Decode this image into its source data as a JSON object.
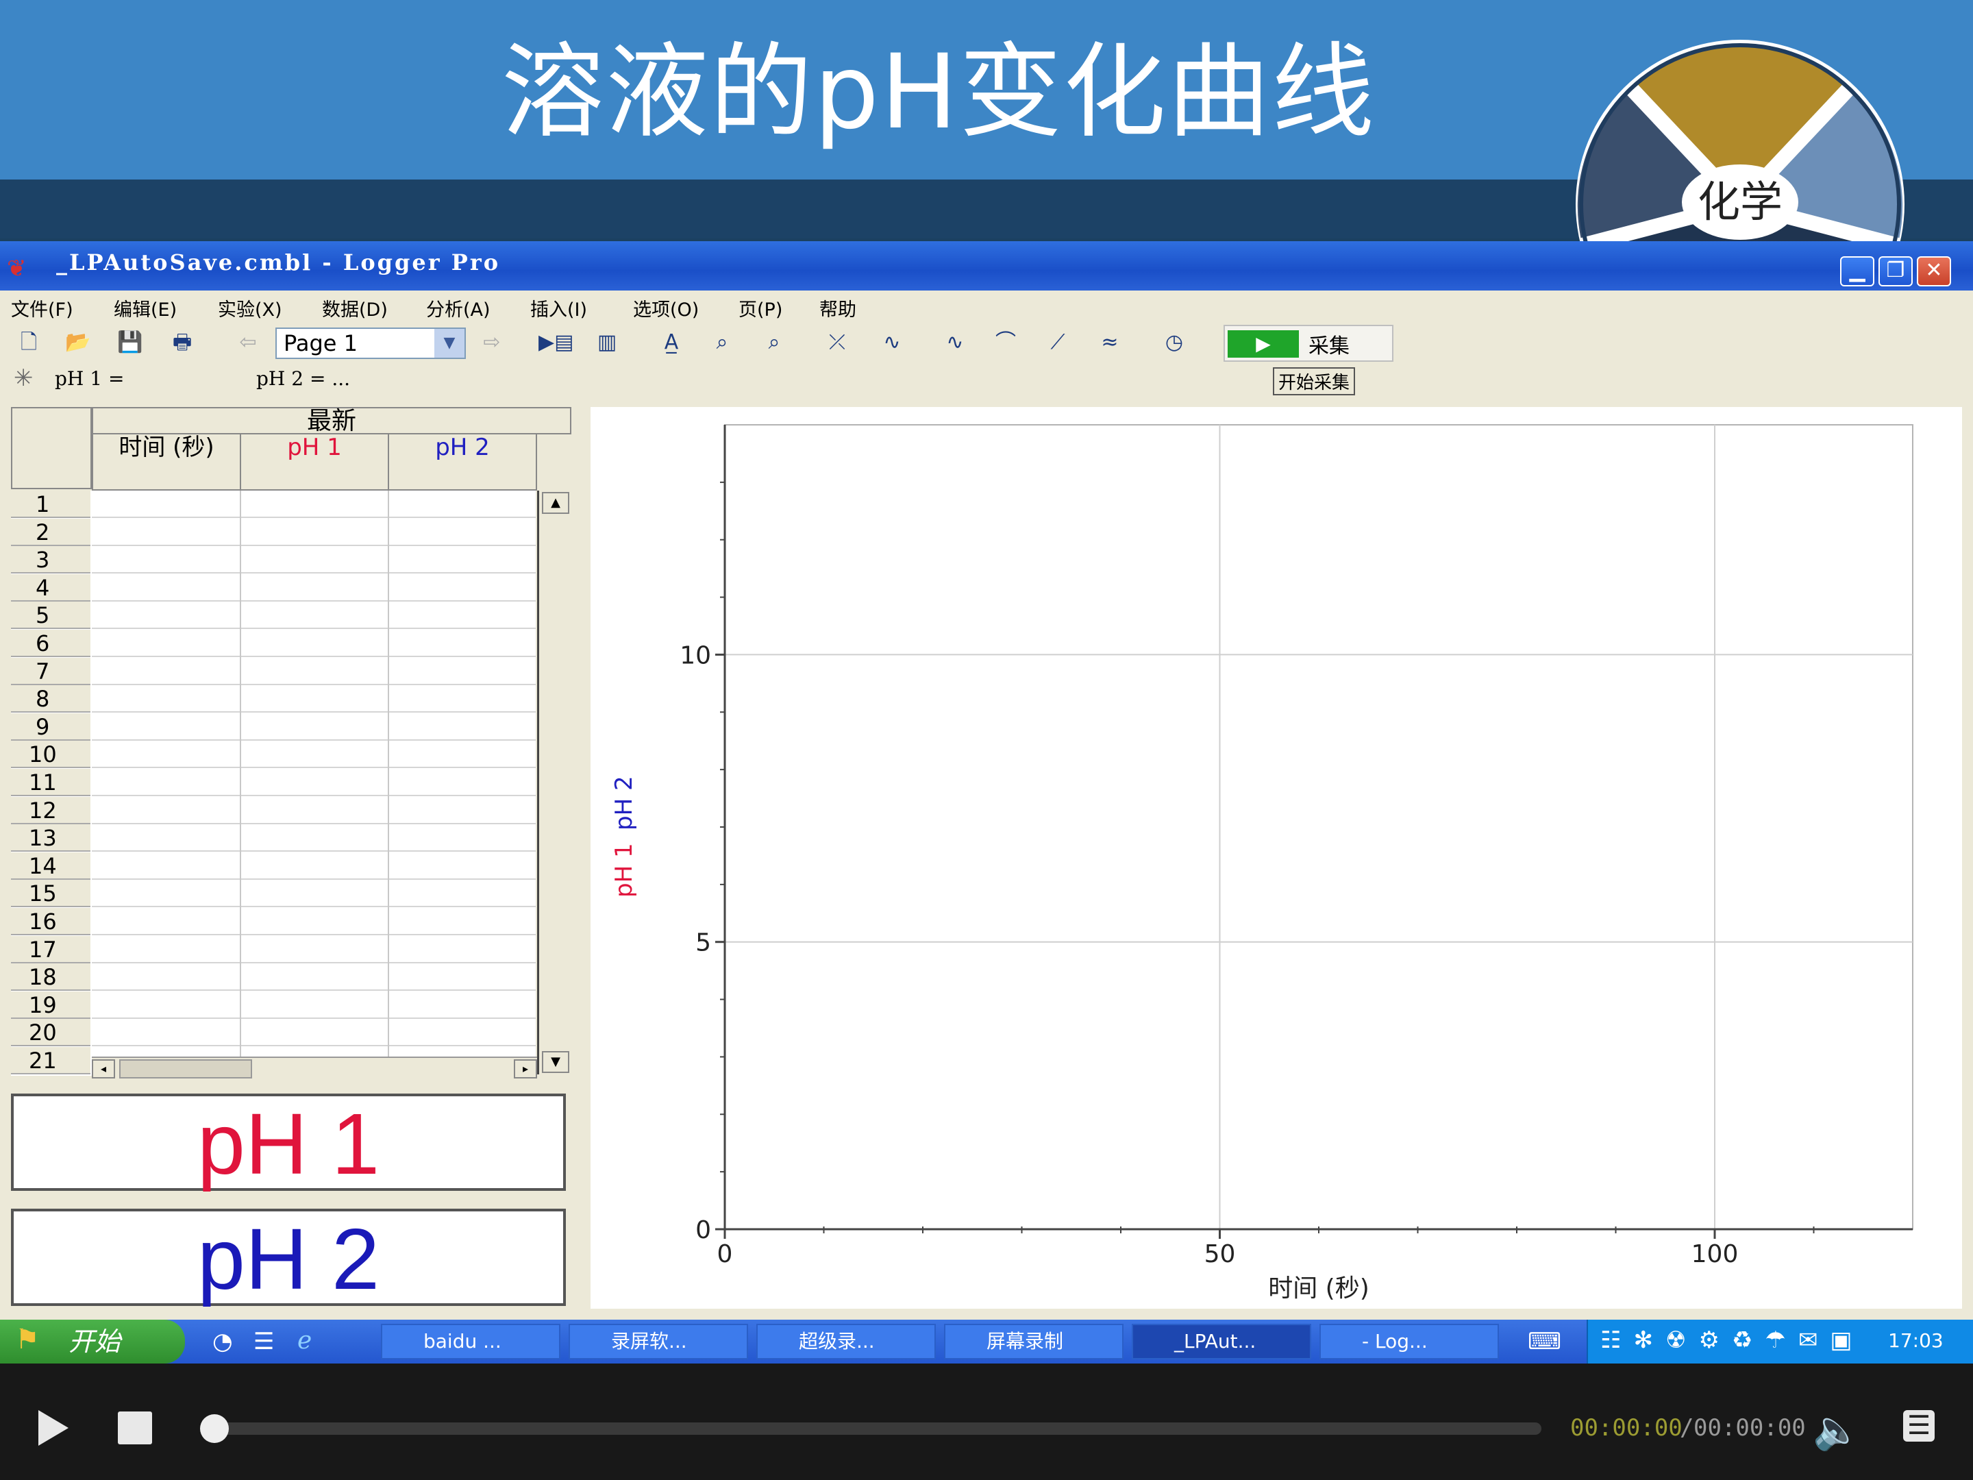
{
  "slide": {
    "title": "溶液的pH变化曲线",
    "logo_label": "化学"
  },
  "window": {
    "title": "_LPAutoSave.cmbl - Logger Pro",
    "controls": [
      "minimize-icon",
      "maximize-icon",
      "close-icon"
    ]
  },
  "menu": [
    "文件(F)",
    "编辑(E)",
    "实验(X)",
    "数据(D)",
    "分析(A)",
    "插入(I)",
    "选项(O)",
    "页(P)",
    "帮助"
  ],
  "toolbar": {
    "page_select": "Page 1",
    "collect_label": "采集"
  },
  "sensors": {
    "s1": "pH 1 =",
    "s2": "pH 2 =   ...",
    "start_label": "开始采集"
  },
  "table": {
    "group_header": "最新",
    "columns": [
      "时间 (秒)",
      "pH 1",
      "pH 2"
    ],
    "column_colors": [
      "#000000",
      "#e0143c",
      "#2020c0"
    ],
    "rows": [
      "1",
      "2",
      "3",
      "4",
      "5",
      "6",
      "7",
      "8",
      "9",
      "10",
      "11",
      "12",
      "13",
      "14",
      "15",
      "16",
      "17",
      "18",
      "19",
      "20",
      "21"
    ]
  },
  "meters": {
    "m1": "pH 1",
    "m2": "pH 2",
    "m1_color": "#e0143c",
    "m2_color": "#1a1ab8"
  },
  "chart_data": {
    "type": "line",
    "series": [],
    "xlabel": "时间 (秒)",
    "ylabel_series": [
      "pH 1",
      "pH 2"
    ],
    "ylabel_colors": [
      "#e0143c",
      "#2020c0"
    ],
    "xlim": [
      0,
      120
    ],
    "ylim": [
      0,
      14
    ],
    "x_ticks": [
      0,
      50,
      100
    ],
    "y_ticks": [
      0,
      5,
      10
    ],
    "grid": true
  },
  "taskbar": {
    "start": "开始",
    "tasks": [
      "baidu ...",
      "录屏软...",
      "超级录...",
      "屏幕录制",
      "_LPAut...",
      "- Log..."
    ],
    "clock": "17:03"
  },
  "player": {
    "current_time": "00:00:00",
    "separator": "/",
    "total_time": "00:00:00",
    "progress": 0
  }
}
